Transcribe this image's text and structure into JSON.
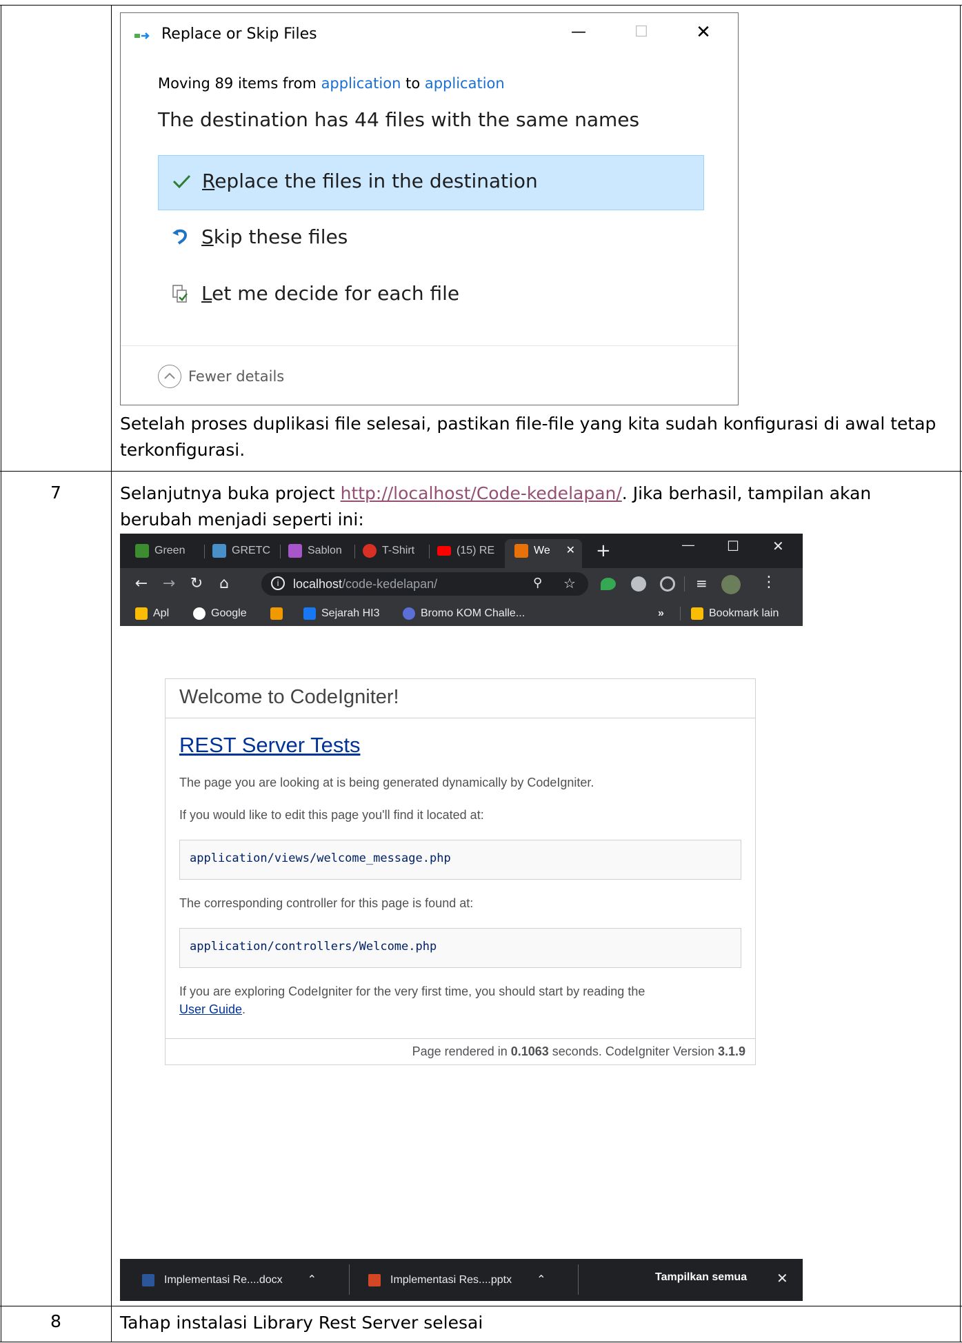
{
  "dialog": {
    "title": "Replace or Skip Files",
    "minimize": "—",
    "maximize": "☐",
    "close": "✕",
    "moving_prefix": "Moving 89 items from ",
    "moving_from": "application",
    "moving_mid": " to ",
    "moving_to": "application",
    "destination_note": "The destination has 44 files with the same names",
    "options": [
      {
        "first": "R",
        "rest": "eplace the files in the destination",
        "icon": "check-icon"
      },
      {
        "first": "S",
        "rest": "kip these files",
        "icon": "skip-arrow-icon"
      },
      {
        "first": "L",
        "rest": "et me decide for each file",
        "icon": "decide-file-icon"
      }
    ],
    "fewer_details": "Fewer details"
  },
  "row6_note": "Setelah proses duplikasi file selesai, pastikan file-file yang kita sudah konfigurasi di awal tetap terkonfigurasi.",
  "row7": {
    "number": "7",
    "text_before": "Selanjutnya buka project ",
    "link": "http://localhost/Code-kedelapan/",
    "text_after": ". Jika berhasil, tampilan akan berubah menjadi seperti ini:"
  },
  "row8": {
    "number": "8",
    "text": "Tahap instalasi Library Rest Server selesai"
  },
  "browser": {
    "tabs": [
      {
        "label": "Green",
        "color": "#3c8d2f"
      },
      {
        "label": "GRETC",
        "color": "#4a90c8"
      },
      {
        "label": "Sablon",
        "color": "#a855c9"
      },
      {
        "label": "T-Shirt",
        "color": "#d93025"
      },
      {
        "label": "(15) RE",
        "color": "#ff0000"
      },
      {
        "label": "We",
        "color": "#e8710a"
      }
    ],
    "new_tab": "+",
    "tab_close": "✕",
    "win_min": "—",
    "win_max": "☐",
    "win_close": "✕",
    "url_host": "localhost",
    "url_path": "/code-kedelapan/",
    "bookmarks": [
      {
        "label": "Apl",
        "color": "#fbbc04"
      },
      {
        "label": "Google",
        "color": "#ffffff"
      },
      {
        "label": "",
        "color": "#f29900"
      },
      {
        "label": "Sejarah HI3",
        "color": "#1877f2"
      },
      {
        "label": "Bromo KOM Challe...",
        "color": "#5b6fd8"
      }
    ],
    "more_bookmarks": "»",
    "other_bookmarks": "Bookmark lain",
    "page": {
      "heading": "Welcome to CodeIgniter!",
      "subheading": "REST Server Tests",
      "p1": "The page you are looking at is being generated dynamically by CodeIgniter.",
      "p2": "If you would like to edit this page you'll find it located at:",
      "code1": "application/views/welcome_message.php",
      "p3": "The corresponding controller for this page is found at:",
      "code2": "application/controllers/Welcome.php",
      "p4": "If you are exploring CodeIgniter for the very first time, you should start by reading the",
      "user_guide": "User Guide",
      "p4_end": ".",
      "footer_prefix": "Page rendered in ",
      "footer_time": "0.1063",
      "footer_mid": " seconds. CodeIgniter Version ",
      "footer_version": "3.1.9"
    },
    "downloads": [
      {
        "label": "Implementasi Re....docx",
        "color": "#2b579a"
      },
      {
        "label": "Implementasi Res....pptx",
        "color": "#d24726"
      }
    ],
    "show_all": "Tampilkan semua",
    "close_bar": "✕"
  }
}
